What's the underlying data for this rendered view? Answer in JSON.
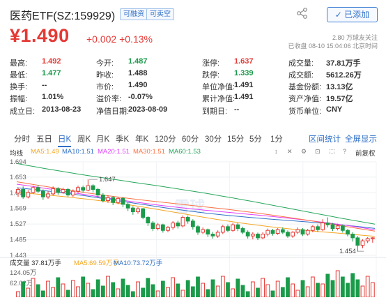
{
  "header": {
    "title": "医药ETF(SZ:159929)",
    "tags": [
      "可融资",
      "可卖空"
    ],
    "add_button": "✓ 已添加",
    "share_icon": "share-icon"
  },
  "quote": {
    "price": "¥1.490",
    "change": "+0.002 +0.13%",
    "followers": "2.80 万球友关注",
    "status": "已收盘 08-10 15:04:06 北京时间"
  },
  "stats": [
    [
      [
        "最高:",
        "1.492",
        "red"
      ],
      [
        "今开:",
        "1.487",
        "green"
      ],
      [
        "涨停:",
        "1.637",
        "red"
      ],
      [
        "成交量:",
        "37.81万手",
        "dark"
      ]
    ],
    [
      [
        "最低:",
        "1.477",
        "green"
      ],
      [
        "昨收:",
        "1.488",
        "dark"
      ],
      [
        "跌停:",
        "1.339",
        "green"
      ],
      [
        "成交额:",
        "5612.26万",
        "dark"
      ]
    ],
    [
      [
        "换手:",
        "--",
        "dark"
      ],
      [
        "市价:",
        "1.490",
        "dark"
      ],
      [
        "单位净值:",
        "1.491",
        "dark"
      ],
      [
        "基金份额:",
        "13.13亿",
        "dark"
      ]
    ],
    [
      [
        "振幅:",
        "1.01%",
        "dark"
      ],
      [
        "溢价率:",
        "-0.07%",
        "dark"
      ],
      [
        "累计净值:",
        "1.491",
        "dark"
      ],
      [
        "资产净值:",
        "19.57亿",
        "dark"
      ]
    ],
    [
      [
        "成立日:",
        "2013-08-23",
        "dark"
      ],
      [
        "净值日期:",
        "2023-08-09",
        "dark"
      ],
      [
        "到期日:",
        "--",
        "dark"
      ],
      [
        "货币单位:",
        "CNY",
        "dark"
      ]
    ]
  ],
  "tabs": [
    "分时",
    "五日",
    "日K",
    "周K",
    "月K",
    "季K",
    "年K",
    "120分",
    "60分",
    "30分",
    "15分",
    "5分",
    "1分"
  ],
  "active_tab": "日K",
  "right_links": [
    "区间统计",
    "全屏显示"
  ],
  "ma_legend": {
    "label": "均线",
    "items": [
      {
        "text": "MA5:1.49",
        "color": "#f5a623"
      },
      {
        "text": "MA10:1.51",
        "color": "#2f6fc7"
      },
      {
        "text": "MA20:1.51",
        "color": "#e040fb"
      },
      {
        "text": "MA30:1.51",
        "color": "#ff7043"
      },
      {
        "text": "MA60:1.53",
        "color": "#26a65b"
      }
    ],
    "adjust": "前复权"
  },
  "chart_data": {
    "type": "candlestick",
    "y_ticks": [
      "1.694",
      "1.653",
      "1.611",
      "1.569",
      "1.527",
      "1.485",
      "1.443"
    ],
    "ylim": [
      1.443,
      1.694
    ],
    "high_annotation": "1.647",
    "low_annotation": "1.454",
    "candles": [
      [
        1.61,
        1.62,
        1.6,
        1.625
      ],
      [
        1.62,
        1.6,
        1.595,
        1.628
      ],
      [
        1.6,
        1.612,
        1.596,
        1.618
      ],
      [
        1.612,
        1.625,
        1.608,
        1.63
      ],
      [
        1.625,
        1.615,
        1.61,
        1.632
      ],
      [
        1.615,
        1.6,
        1.592,
        1.62
      ],
      [
        1.6,
        1.608,
        1.595,
        1.615
      ],
      [
        1.608,
        1.622,
        1.604,
        1.628
      ],
      [
        1.622,
        1.612,
        1.606,
        1.626
      ],
      [
        1.612,
        1.62,
        1.608,
        1.625
      ],
      [
        1.62,
        1.605,
        1.6,
        1.624
      ],
      [
        1.605,
        1.615,
        1.6,
        1.62
      ],
      [
        1.615,
        1.625,
        1.61,
        1.63
      ],
      [
        1.625,
        1.618,
        1.612,
        1.63
      ],
      [
        1.618,
        1.63,
        1.615,
        1.647
      ],
      [
        1.63,
        1.62,
        1.612,
        1.634
      ],
      [
        1.62,
        1.605,
        1.598,
        1.624
      ],
      [
        1.605,
        1.59,
        1.585,
        1.61
      ],
      [
        1.59,
        1.598,
        1.584,
        1.604
      ],
      [
        1.598,
        1.585,
        1.578,
        1.602
      ],
      [
        1.585,
        1.596,
        1.58,
        1.6
      ],
      [
        1.596,
        1.58,
        1.572,
        1.6
      ],
      [
        1.58,
        1.57,
        1.562,
        1.586
      ],
      [
        1.57,
        1.56,
        1.552,
        1.575
      ],
      [
        1.56,
        1.568,
        1.555,
        1.572
      ],
      [
        1.568,
        1.545,
        1.54,
        1.57
      ],
      [
        1.545,
        1.53,
        1.522,
        1.548
      ],
      [
        1.53,
        1.515,
        1.508,
        1.535
      ],
      [
        1.515,
        1.525,
        1.51,
        1.53
      ],
      [
        1.525,
        1.51,
        1.504,
        1.528
      ],
      [
        1.51,
        1.518,
        1.505,
        1.522
      ],
      [
        1.518,
        1.53,
        1.512,
        1.535
      ],
      [
        1.53,
        1.522,
        1.515,
        1.536
      ],
      [
        1.522,
        1.545,
        1.518,
        1.55
      ],
      [
        1.545,
        1.535,
        1.528,
        1.55
      ],
      [
        1.535,
        1.52,
        1.512,
        1.54
      ],
      [
        1.52,
        1.505,
        1.498,
        1.524
      ],
      [
        1.505,
        1.512,
        1.5,
        1.518
      ],
      [
        1.512,
        1.5,
        1.492,
        1.515
      ],
      [
        1.5,
        1.495,
        1.488,
        1.506
      ],
      [
        1.495,
        1.505,
        1.49,
        1.51
      ],
      [
        1.505,
        1.52,
        1.5,
        1.525
      ],
      [
        1.52,
        1.51,
        1.505,
        1.526
      ],
      [
        1.51,
        1.525,
        1.506,
        1.53
      ],
      [
        1.525,
        1.515,
        1.508,
        1.53
      ],
      [
        1.515,
        1.505,
        1.5,
        1.52
      ],
      [
        1.505,
        1.495,
        1.488,
        1.51
      ],
      [
        1.495,
        1.5,
        1.486,
        1.505
      ],
      [
        1.5,
        1.49,
        1.484,
        1.504
      ],
      [
        1.49,
        1.5,
        1.486,
        1.505
      ],
      [
        1.5,
        1.51,
        1.494,
        1.515
      ],
      [
        1.51,
        1.502,
        1.496,
        1.514
      ],
      [
        1.502,
        1.512,
        1.498,
        1.516
      ],
      [
        1.512,
        1.505,
        1.5,
        1.518
      ],
      [
        1.505,
        1.495,
        1.49,
        1.51
      ],
      [
        1.495,
        1.505,
        1.49,
        1.508
      ],
      [
        1.505,
        1.512,
        1.5,
        1.518
      ],
      [
        1.512,
        1.5,
        1.495,
        1.516
      ],
      [
        1.5,
        1.51,
        1.496,
        1.514
      ],
      [
        1.51,
        1.52,
        1.505,
        1.524
      ],
      [
        1.52,
        1.512,
        1.506,
        1.526
      ],
      [
        1.512,
        1.53,
        1.508,
        1.54
      ],
      [
        1.53,
        1.525,
        1.518,
        1.545
      ],
      [
        1.525,
        1.515,
        1.508,
        1.53
      ],
      [
        1.515,
        1.522,
        1.51,
        1.528
      ],
      [
        1.522,
        1.51,
        1.504,
        1.526
      ],
      [
        1.51,
        1.5,
        1.494,
        1.514
      ],
      [
        1.5,
        1.49,
        1.48,
        1.505
      ],
      [
        1.49,
        1.47,
        1.454,
        1.495
      ],
      [
        1.47,
        1.482,
        1.462,
        1.486
      ],
      [
        1.482,
        1.488,
        1.476,
        1.492
      ],
      [
        1.488,
        1.49,
        1.477,
        1.492
      ]
    ],
    "ma_lines": [
      {
        "name": "MA5",
        "color": "#f5a623",
        "from": 1.612,
        "to": 1.49
      },
      {
        "name": "MA10",
        "color": "#2f6fc7",
        "from": 1.62,
        "to": 1.51
      },
      {
        "name": "MA20",
        "color": "#e040fb",
        "from": 1.63,
        "to": 1.51
      },
      {
        "name": "MA30",
        "color": "#ff7043",
        "from": 1.64,
        "to": 1.51
      },
      {
        "name": "MA60",
        "color": "#26a65b",
        "from": 1.692,
        "to": 1.53
      }
    ]
  },
  "volume": {
    "legend": [
      {
        "text": "成交量 37.81万手",
        "color": "#333"
      },
      {
        "text": "MA5:69.59万手",
        "color": "#f5a623"
      },
      {
        "text": "MA10:73.72万手",
        "color": "#2f6fc7"
      }
    ],
    "y_ticks": [
      "124.05万",
      "62.02万"
    ],
    "ymax": 124.05
  },
  "watermark": "雪球"
}
